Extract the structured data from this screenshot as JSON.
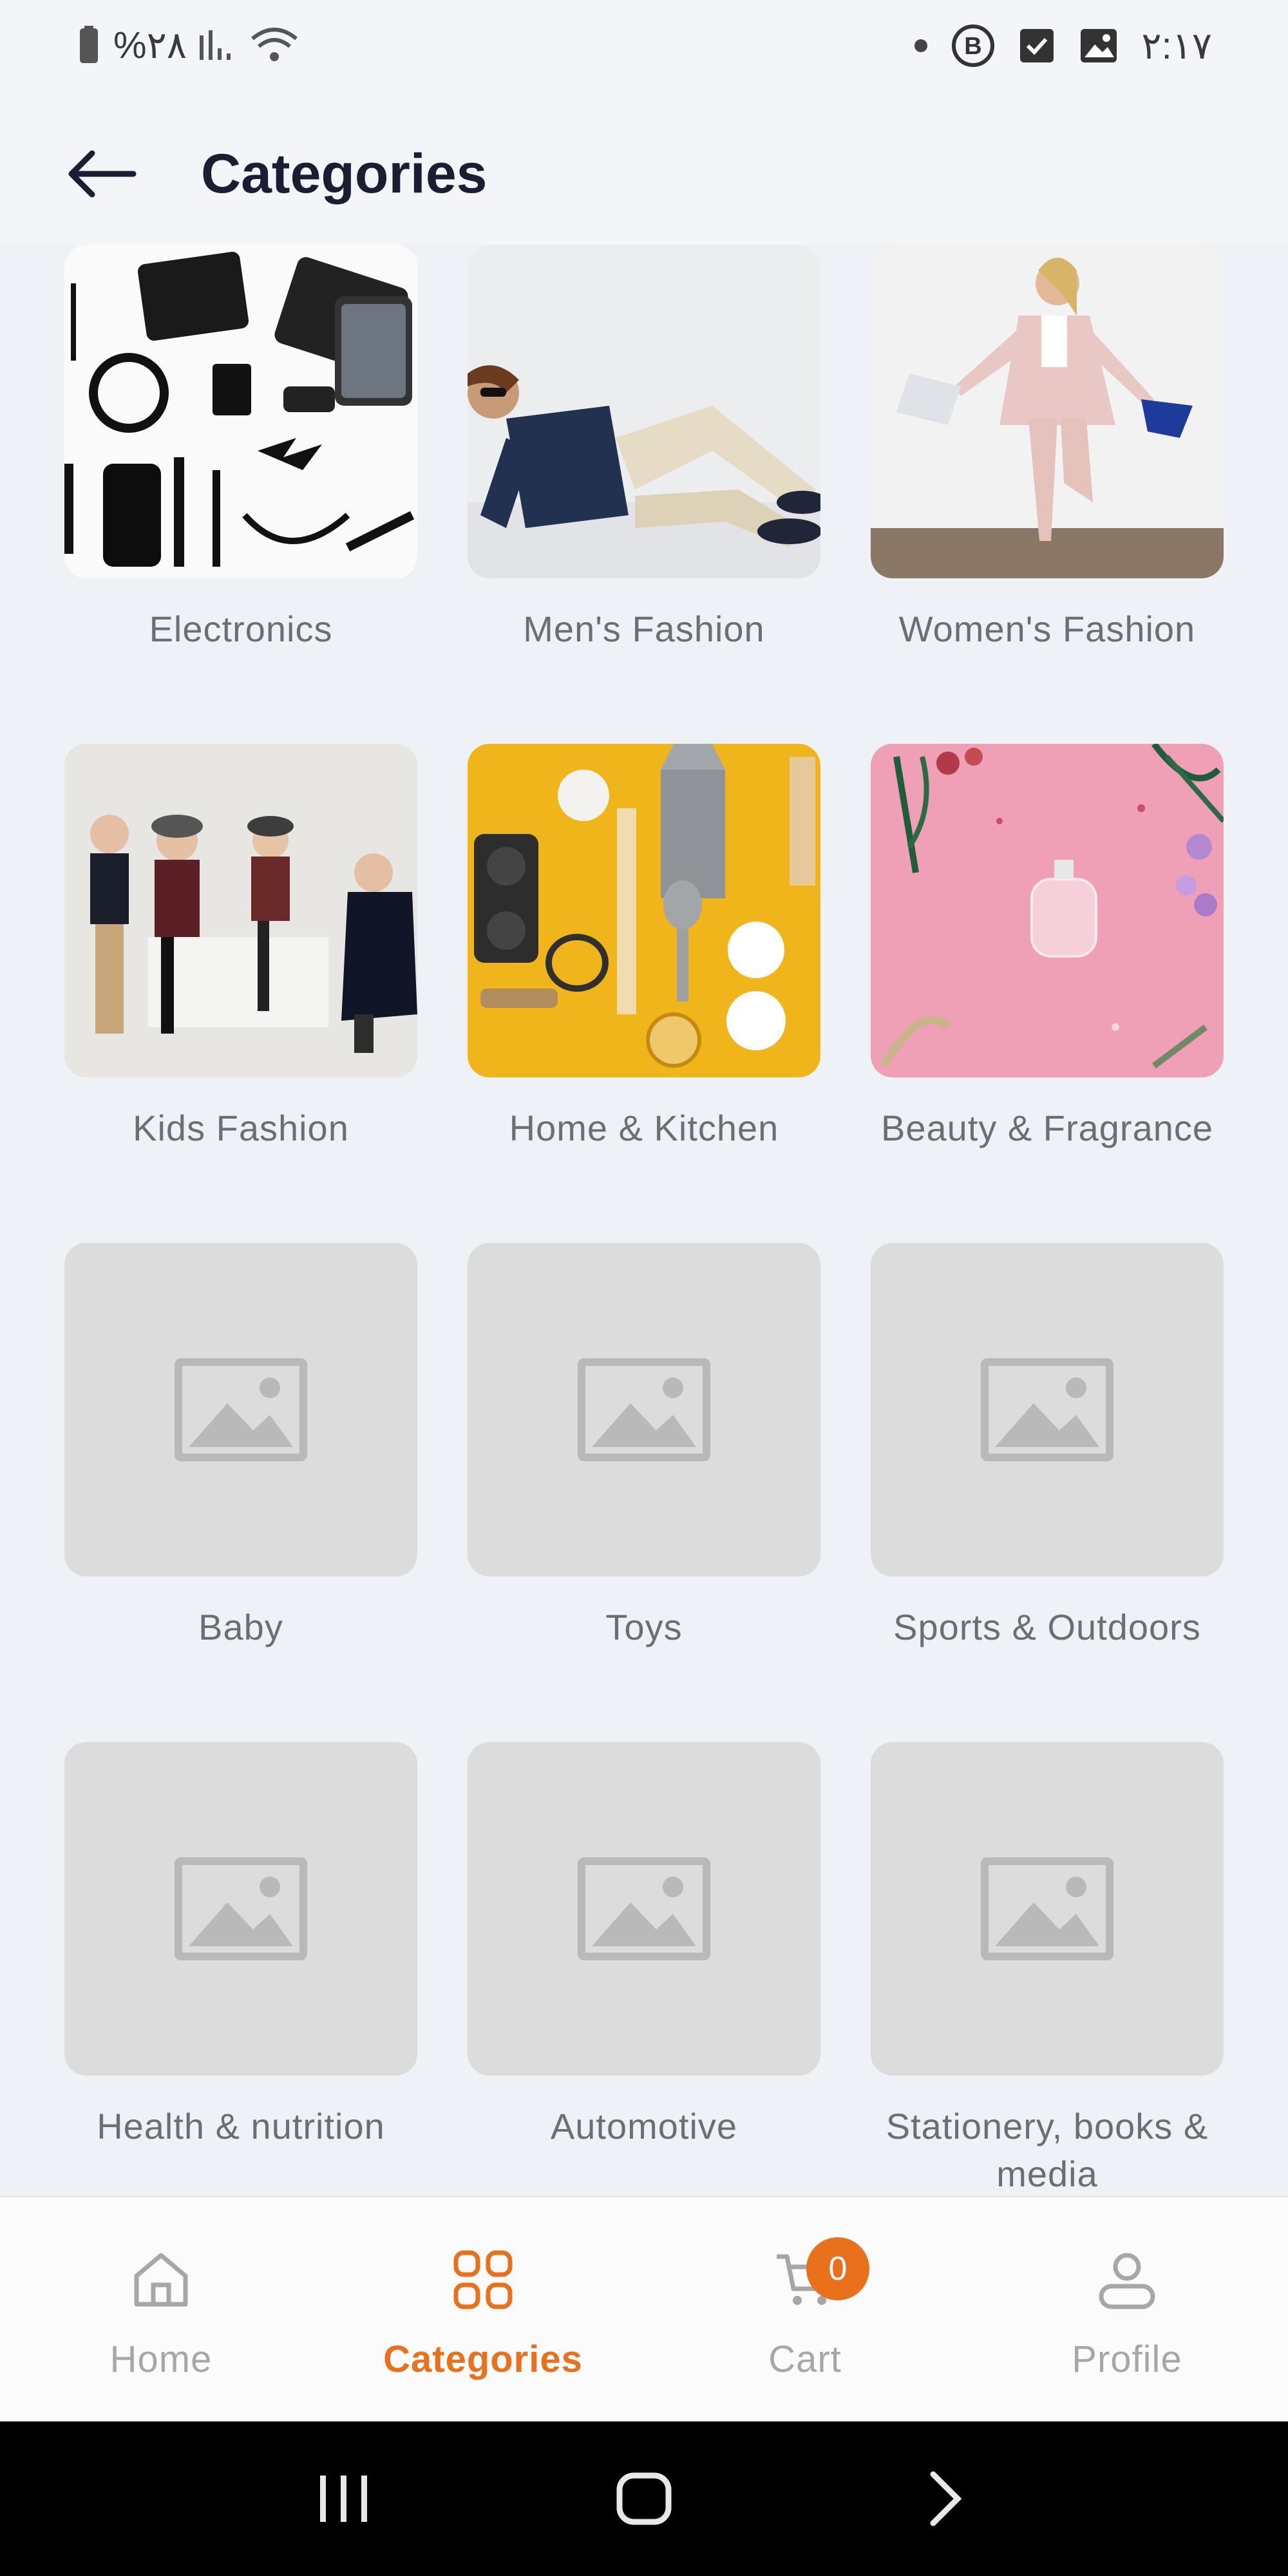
{
  "status_bar": {
    "battery": "%۲۸",
    "time": "۲:۱۷"
  },
  "header": {
    "title": "Categories"
  },
  "categories": [
    {
      "label": "Electronics",
      "image": "electronics-photo"
    },
    {
      "label": "Men's Fashion",
      "image": "mens-fashion-photo"
    },
    {
      "label": "Women's Fashion",
      "image": "womens-fashion-photo"
    },
    {
      "label": "Kids Fashion",
      "image": "kids-fashion-photo"
    },
    {
      "label": "Home & Kitchen",
      "image": "home-kitchen-photo"
    },
    {
      "label": "Beauty & Fragrance",
      "image": "beauty-fragrance-photo"
    },
    {
      "label": "Baby",
      "image": "placeholder-image-icon"
    },
    {
      "label": "Toys",
      "image": "placeholder-image-icon"
    },
    {
      "label": "Sports & Outdoors",
      "image": "placeholder-image-icon"
    },
    {
      "label": "Health & nutrition",
      "image": "placeholder-image-icon"
    },
    {
      "label": "Automotive",
      "image": "placeholder-image-icon"
    },
    {
      "label": "Stationery, books & media",
      "image": "placeholder-image-icon"
    }
  ],
  "bottom_nav": {
    "items": [
      {
        "label": "Home",
        "icon": "home-icon",
        "active": false
      },
      {
        "label": "Categories",
        "icon": "categories-icon",
        "active": true
      },
      {
        "label": "Cart",
        "icon": "cart-icon",
        "active": false
      },
      {
        "label": "Profile",
        "icon": "profile-icon",
        "active": false
      }
    ],
    "cart_count": "0"
  },
  "colors": {
    "accent": "#e9711c",
    "title": "#1b1d33",
    "label": "#6b6e73",
    "nav_inactive": "#a7a7a7",
    "background": "#eef1f5"
  }
}
